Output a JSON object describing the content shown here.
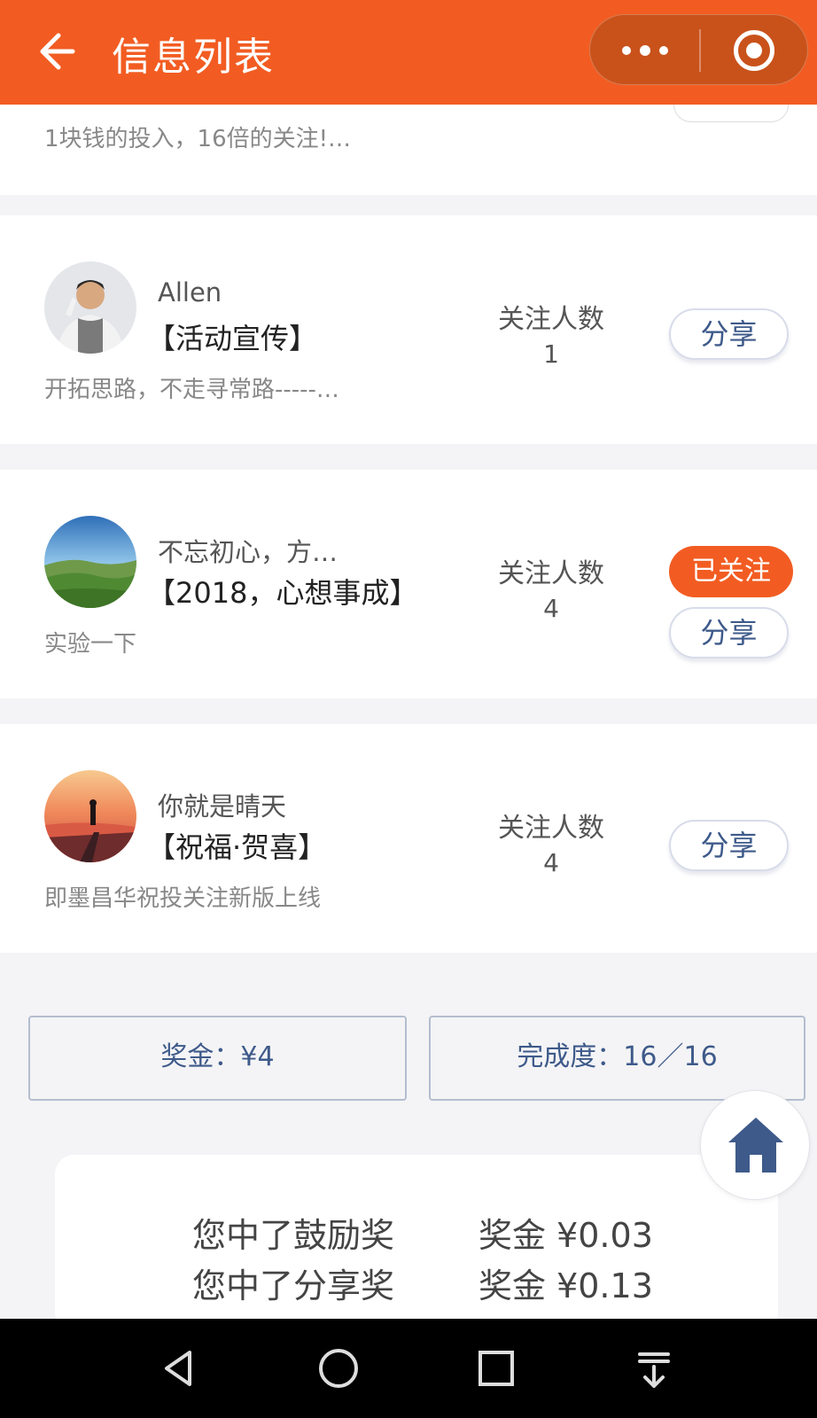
{
  "header": {
    "title": "信息列表",
    "back_icon": "arrow-left-icon",
    "more_icon": "more-dots-icon",
    "record_icon": "record-circle-icon",
    "bg_color": "#f25c22"
  },
  "partial_card": {
    "desc": "1块钱的投入，16倍的关注!…"
  },
  "items": [
    {
      "name": "Allen",
      "tag": "【活动宣传】",
      "desc": "开拓思路，不走寻常路-----…",
      "follow_label": "关注人数",
      "follow_count": "1",
      "followed": false,
      "share_label": "分享"
    },
    {
      "name": "不忘初心，方…",
      "tag": "【2018，心想事成】",
      "desc": "实验一下",
      "follow_label": "关注人数",
      "follow_count": "4",
      "followed": true,
      "followed_label": "已关注",
      "share_label": "分享"
    },
    {
      "name": "你就是晴天",
      "tag": "【祝福·贺喜】",
      "desc": "即墨昌华祝投关注新版上线",
      "follow_label": "关注人数",
      "follow_count": "4",
      "followed": false,
      "share_label": "分享"
    }
  ],
  "summary": {
    "bonus": "奖金：¥4",
    "completion": "完成度：16／16"
  },
  "home_icon": "home-icon",
  "prizes": [
    {
      "name": "您中了鼓励奖",
      "amount": "奖金 ¥0.03"
    },
    {
      "name": "您中了分享奖",
      "amount": "奖金 ¥0.13"
    }
  ],
  "system_nav": {
    "back_icon": "triangle-back-icon",
    "home_icon": "circle-home-icon",
    "recents_icon": "square-recents-icon",
    "notification_icon": "pull-down-icon"
  }
}
